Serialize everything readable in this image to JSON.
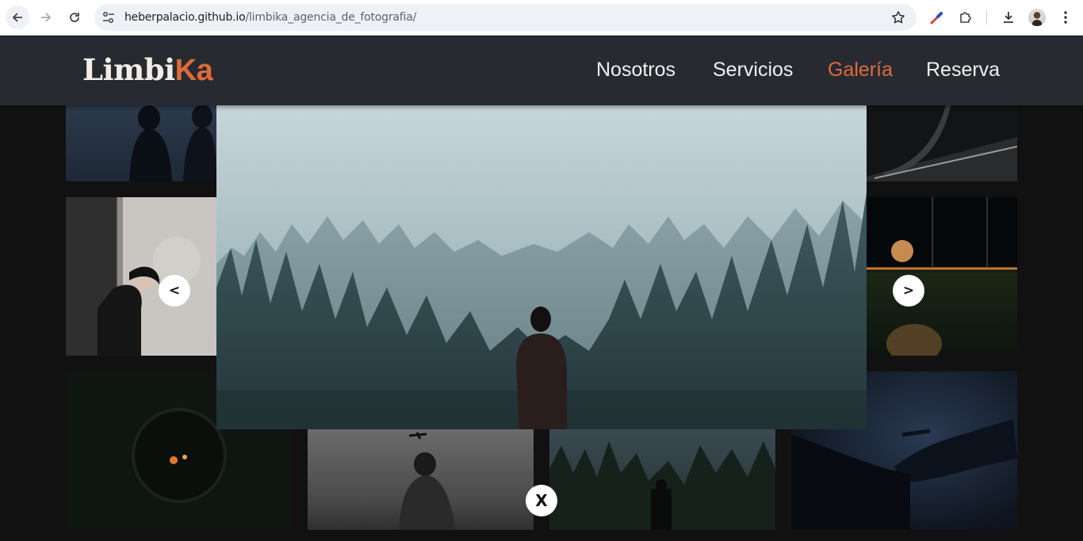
{
  "browser": {
    "url_host": "heberpalacio.github.io",
    "url_path": "/limbika_agencia_de_fotografia/",
    "icons": [
      "back-arrow-icon",
      "forward-arrow-icon",
      "reload-icon",
      "site-settings-icon",
      "bookmark-star-icon",
      "eyedropper-icon",
      "extensions-icon",
      "download-icon",
      "profile-avatar",
      "kebab-menu-icon"
    ]
  },
  "site": {
    "logo_part1": "Limbi",
    "logo_part2": "Ka",
    "nav": [
      {
        "label": "Nosotros",
        "active": false
      },
      {
        "label": "Servicios",
        "active": false
      },
      {
        "label": "Galería",
        "active": true
      },
      {
        "label": "Reserva",
        "active": false
      }
    ],
    "colors": {
      "header_bg": "#272b31",
      "accent": "#e06a3a",
      "page_bg": "#111111"
    }
  },
  "lightbox": {
    "prev_label": "<",
    "next_label": ">",
    "close_label": "X"
  }
}
